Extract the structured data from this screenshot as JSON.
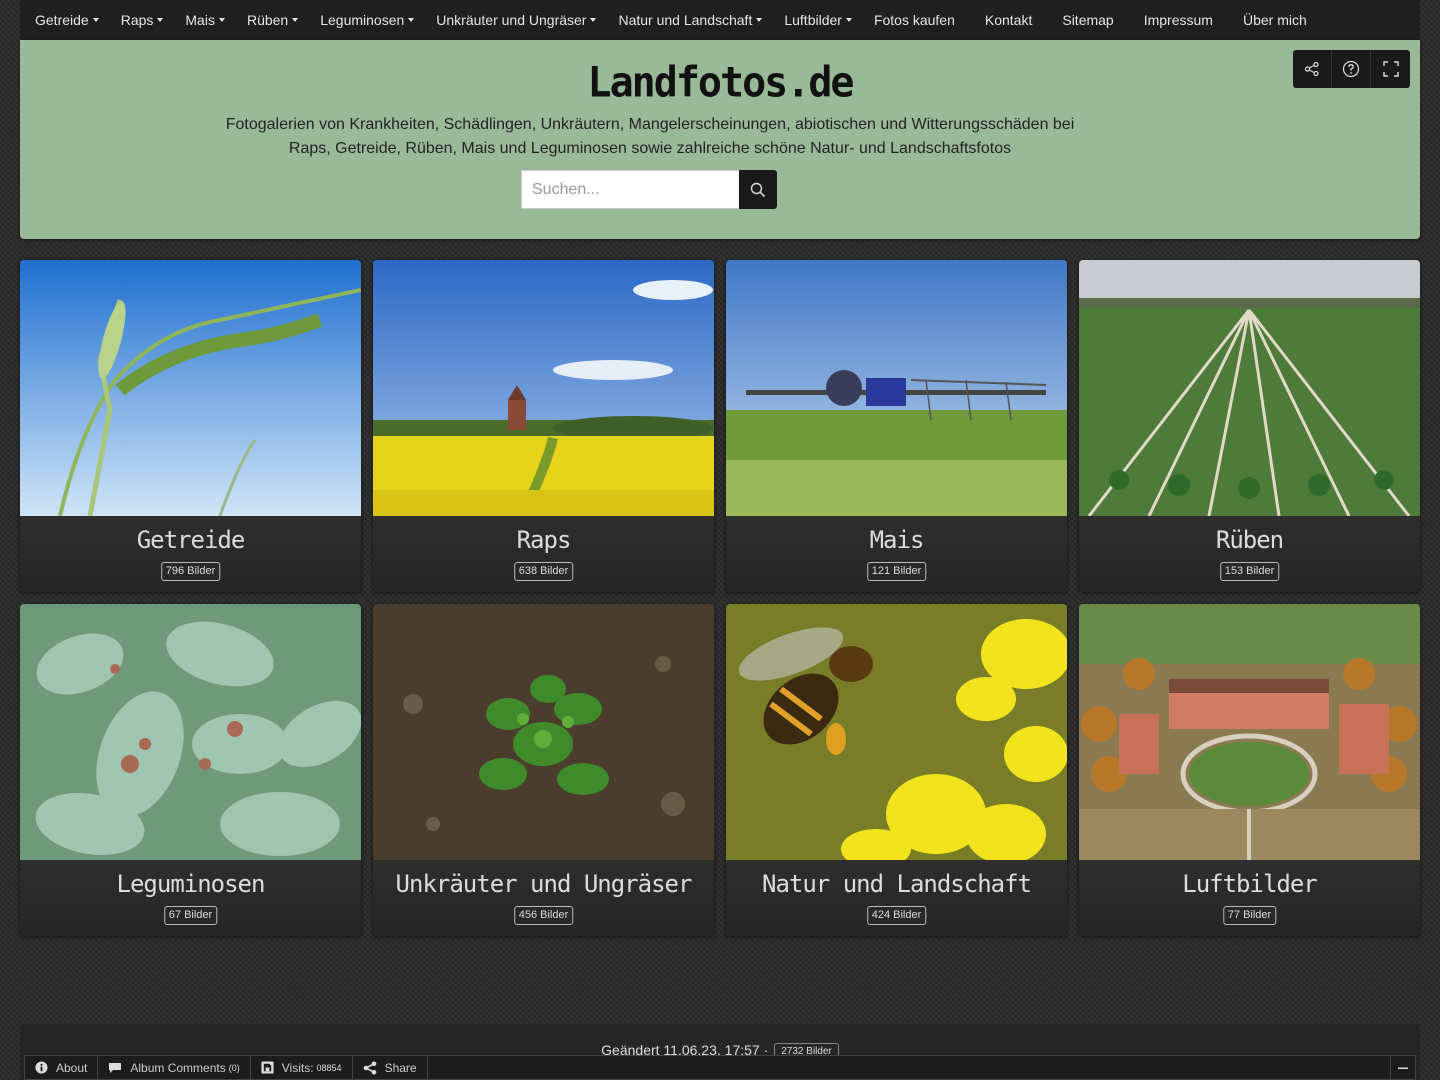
{
  "nav": [
    {
      "label": "Getreide",
      "dropdown": true
    },
    {
      "label": "Raps",
      "dropdown": true
    },
    {
      "label": "Mais",
      "dropdown": true
    },
    {
      "label": "Rüben",
      "dropdown": true
    },
    {
      "label": "Leguminosen",
      "dropdown": true
    },
    {
      "label": "Unkräuter und Ungräser",
      "dropdown": true
    },
    {
      "label": "Natur und Landschaft",
      "dropdown": true
    },
    {
      "label": "Luftbilder",
      "dropdown": true
    },
    {
      "label": "Fotos kaufen",
      "dropdown": false
    },
    {
      "label": "Kontakt",
      "dropdown": false
    },
    {
      "label": "Sitemap",
      "dropdown": false
    },
    {
      "label": "Impressum",
      "dropdown": false
    },
    {
      "label": "Über mich",
      "dropdown": false
    }
  ],
  "header": {
    "title": "Landfotos.de",
    "description_line1": "Fotogalerien von Krankheiten, Schädlingen, Unkräutern, Mangelerscheinungen, abiotischen und Witterungsschäden bei",
    "description_line2": "Raps, Getreide, Rüben, Mais und Leguminosen sowie zahlreiche schöne Natur- und Landschaftsfotos",
    "search_placeholder": "Suchen...",
    "accent_color": "#99b998",
    "tools": [
      "share-icon",
      "help-icon",
      "fullscreen-icon"
    ]
  },
  "albums": [
    {
      "title": "Getreide",
      "count": "796 Bilder"
    },
    {
      "title": "Raps",
      "count": "638 Bilder"
    },
    {
      "title": "Mais",
      "count": "121 Bilder"
    },
    {
      "title": "Rüben",
      "count": "153 Bilder"
    },
    {
      "title": "Leguminosen",
      "count": "67 Bilder"
    },
    {
      "title": "Unkräuter und Ungräser",
      "count": "456 Bilder"
    },
    {
      "title": "Natur und Landschaft",
      "count": "424 Bilder"
    },
    {
      "title": "Luftbilder",
      "count": "77 Bilder"
    }
  ],
  "footer": {
    "changed": "Geändert 11.06.23, 17:57 ·",
    "total": "2732 Bilder"
  },
  "statusbar": {
    "about": "About",
    "comments": "Album Comments",
    "comments_count": "(0)",
    "visits": "Visits:",
    "visits_count": "08854",
    "share": "Share"
  }
}
